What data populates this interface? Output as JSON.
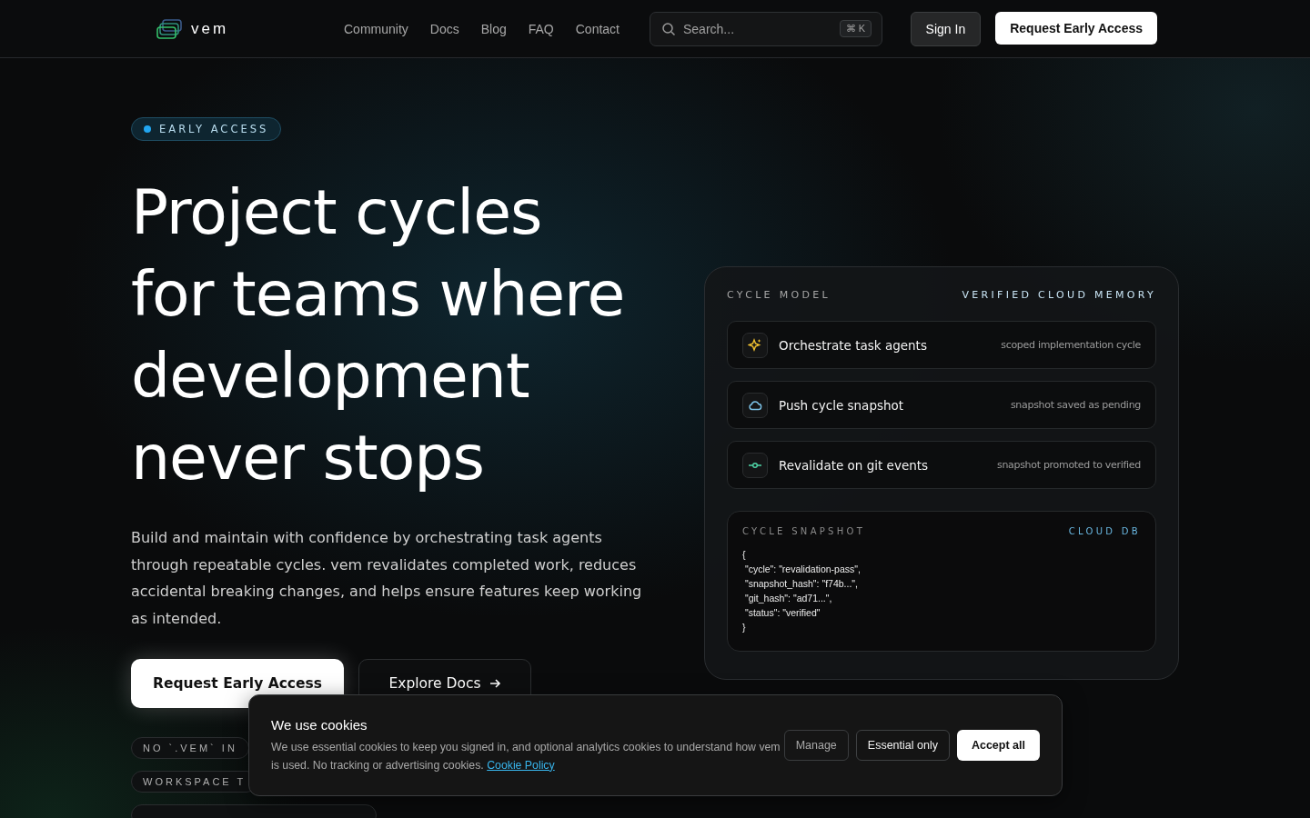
{
  "header": {
    "logo": "vem",
    "nav": [
      "Community",
      "Docs",
      "Blog",
      "FAQ",
      "Contact"
    ],
    "search": {
      "placeholder": "Search...",
      "shortcut": "⌘ K"
    },
    "sign_in": "Sign In",
    "cta": "Request Early Access"
  },
  "hero": {
    "badge": "EARLY ACCESS",
    "title_lines": [
      "Project cycles",
      "for teams where",
      "development",
      "never stops"
    ],
    "description": "Build and maintain with confidence by orchestrating task agents through repeatable cycles. vem revalidates completed work, reduces accidental breaking changes, and helps ensure features keep working as intended.",
    "primary_button": "Request Early Access",
    "secondary_button": "Explore Docs",
    "tags": [
      "NO `.VEM` IN",
      "WORKSPACE T"
    ]
  },
  "card": {
    "label": "CYCLE MODEL",
    "label_right": "VERIFIED CLOUD MEMORY",
    "steps": [
      {
        "kind": "sparkle",
        "title": "Orchestrate task agents",
        "note": "scoped implementation cycle"
      },
      {
        "kind": "cloud",
        "title": "Push cycle snapshot",
        "note": "snapshot saved as pending"
      },
      {
        "kind": "commit",
        "title": "Revalidate on git events",
        "note": "snapshot promoted to verified"
      }
    ],
    "snapshot": {
      "label": "CYCLE SNAPSHOT",
      "label_right": "CLOUD DB",
      "code_lines": [
        "{",
        " \"cycle\": \"revalidation-pass\",",
        " \"snapshot_hash\": \"f74b...\",",
        " \"git_hash\": \"ad71...\",",
        " \"status\": \"verified\"",
        "}"
      ]
    }
  },
  "cookie_banner": {
    "title": "We use cookies",
    "text": "We use essential cookies to keep you signed in, and optional analytics cookies to understand how vem is used. No tracking or advertising cookies.",
    "link": "Cookie Policy",
    "buttons": [
      {
        "label": "Manage",
        "kind": "ghost"
      },
      {
        "label": "Essential only",
        "kind": "outline"
      },
      {
        "label": "Accept all",
        "kind": "primary"
      }
    ]
  }
}
